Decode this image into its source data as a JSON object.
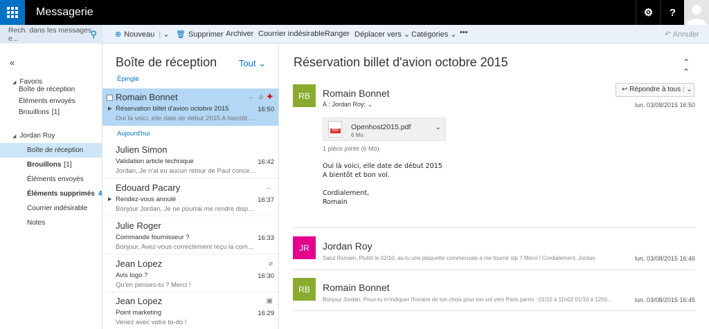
{
  "app": {
    "title": "Messagerie"
  },
  "topbar": {
    "settings_icon": "gear-icon",
    "help_label": "?"
  },
  "command": {
    "search_placeholder": "Rech. dans les messages e...",
    "new": "Nouveau",
    "delete": "Supprimer",
    "archive": "Archiver",
    "junk": "Courrier indésirable",
    "sweep": "Ranger",
    "move": "Déplacer vers",
    "categories": "Catégories",
    "more": "•••",
    "undo": "Annuler"
  },
  "nav": {
    "favorites": {
      "label": "Favoris",
      "items": [
        {
          "label": "Boîte de réception"
        },
        {
          "label": "Éléments envoyés"
        },
        {
          "label": "Brouillons",
          "count": "[1]"
        }
      ]
    },
    "account": {
      "label": "Jordan Roy",
      "items": [
        {
          "label": "Boîte de réception"
        },
        {
          "label": "Brouillons",
          "count": "[1]"
        },
        {
          "label": "Éléments envoyés"
        },
        {
          "label": "Éléments supprimés",
          "count": "4"
        },
        {
          "label": "Courrier indésirable"
        },
        {
          "label": "Notes"
        }
      ]
    }
  },
  "list": {
    "title": "Boîte de réception",
    "filter": "Tout",
    "groups": {
      "pinned": "Épinglé",
      "today": "Aujourd'hui"
    },
    "messages": [
      {
        "sender": "Romain Bonnet",
        "subject": "Réservation billet d'avion octobre 2015",
        "time": "16:50",
        "preview": "Oui là voici, elle date de début 2015  A bientôt et bon vol."
      },
      {
        "sender": "Julien Simon",
        "subject": "Validation article technique",
        "time": "16:42",
        "preview": "Jordan,  Je n'ai eu aucun retour de Paul concernant l'article"
      },
      {
        "sender": "Edouard Pacary",
        "subject": "Rendez-vous annulé",
        "time": "16:37",
        "preview": "Bonjour Jordan,  Je ne pourrai me rendre disponible pour"
      },
      {
        "sender": "Julie Roger",
        "subject": "Commande fournisseur ?",
        "time": "16:33",
        "preview": "Bonjour,  Avez-vous correctement reçu la commande de"
      },
      {
        "sender": "Jean Lopez",
        "subject": "Avis logo ?",
        "time": "16:30",
        "preview": "Qu'en penses-tu ?  Merci !"
      },
      {
        "sender": "Jean Lopez",
        "subject": "Point marketing",
        "time": "16:29",
        "preview": "Venez avec votre to-do !"
      }
    ]
  },
  "reading": {
    "title": "Réservation billet d'avion octobre 2015",
    "main": {
      "initials": "RB",
      "sender": "Romain Bonnet",
      "to_label": "À :",
      "to": "Jordan Roy;",
      "date": "lun. 03/08/2015 16:50",
      "reply_all": "Répondre à tous",
      "attachment": {
        "name": "Openhost2015.pdf",
        "size": "6 Mo",
        "count": "1 pièce jointe (6 Mo)"
      },
      "body": [
        "Oui là voici, elle date de début 2015",
        "A bientôt et bon vol.",
        "Cordialement,",
        "Romain"
      ]
    },
    "replies": [
      {
        "initials": "JR",
        "sender": "Jordan Roy",
        "snippet": "Salut Romain, Plutôt le 02/10, as-tu une plaquette commerciale à me fournir stp ? Merci ! Cordialement, Jordan",
        "date": "lun. 03/08/2015 16:46"
      },
      {
        "initials": "RB",
        "sender": "Romain Bonnet",
        "snippet": "Bonjour Jordan, Peux-tu m'indiquer l'horaire de ton choix pour ton vol vers Paris parmi : 01/10 à 11h02 01/10 à 12h0...",
        "date": "lun. 03/08/2015 16:45"
      }
    ]
  },
  "colors": {
    "accent": "#0072c6",
    "topbar": "#000000",
    "selected": "#b3d7f5",
    "tile_green": "#8bab2f",
    "tile_pink": "#e3008c"
  }
}
